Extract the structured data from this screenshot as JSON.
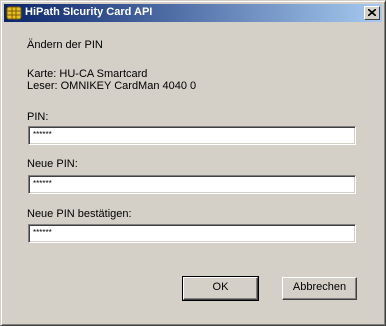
{
  "window": {
    "title": "HiPath SIcurity Card API"
  },
  "dialog": {
    "heading": "Ändern der PIN",
    "card_line": "Karte: HU-CA Smartcard",
    "reader_line": "Leser: OMNIKEY CardMan 4040 0"
  },
  "fields": {
    "pin_label": "PIN:",
    "pin_value": "******",
    "new_pin_label": "Neue PIN:",
    "new_pin_value": "******",
    "confirm_pin_label": "Neue PIN bestätigen:",
    "confirm_pin_value": "******"
  },
  "buttons": {
    "ok_label": "OK",
    "cancel_label": "Abbrechen"
  },
  "colors": {
    "titlebar_start": "#0a246a",
    "titlebar_end": "#a6caf0",
    "face": "#d4d0c8"
  }
}
